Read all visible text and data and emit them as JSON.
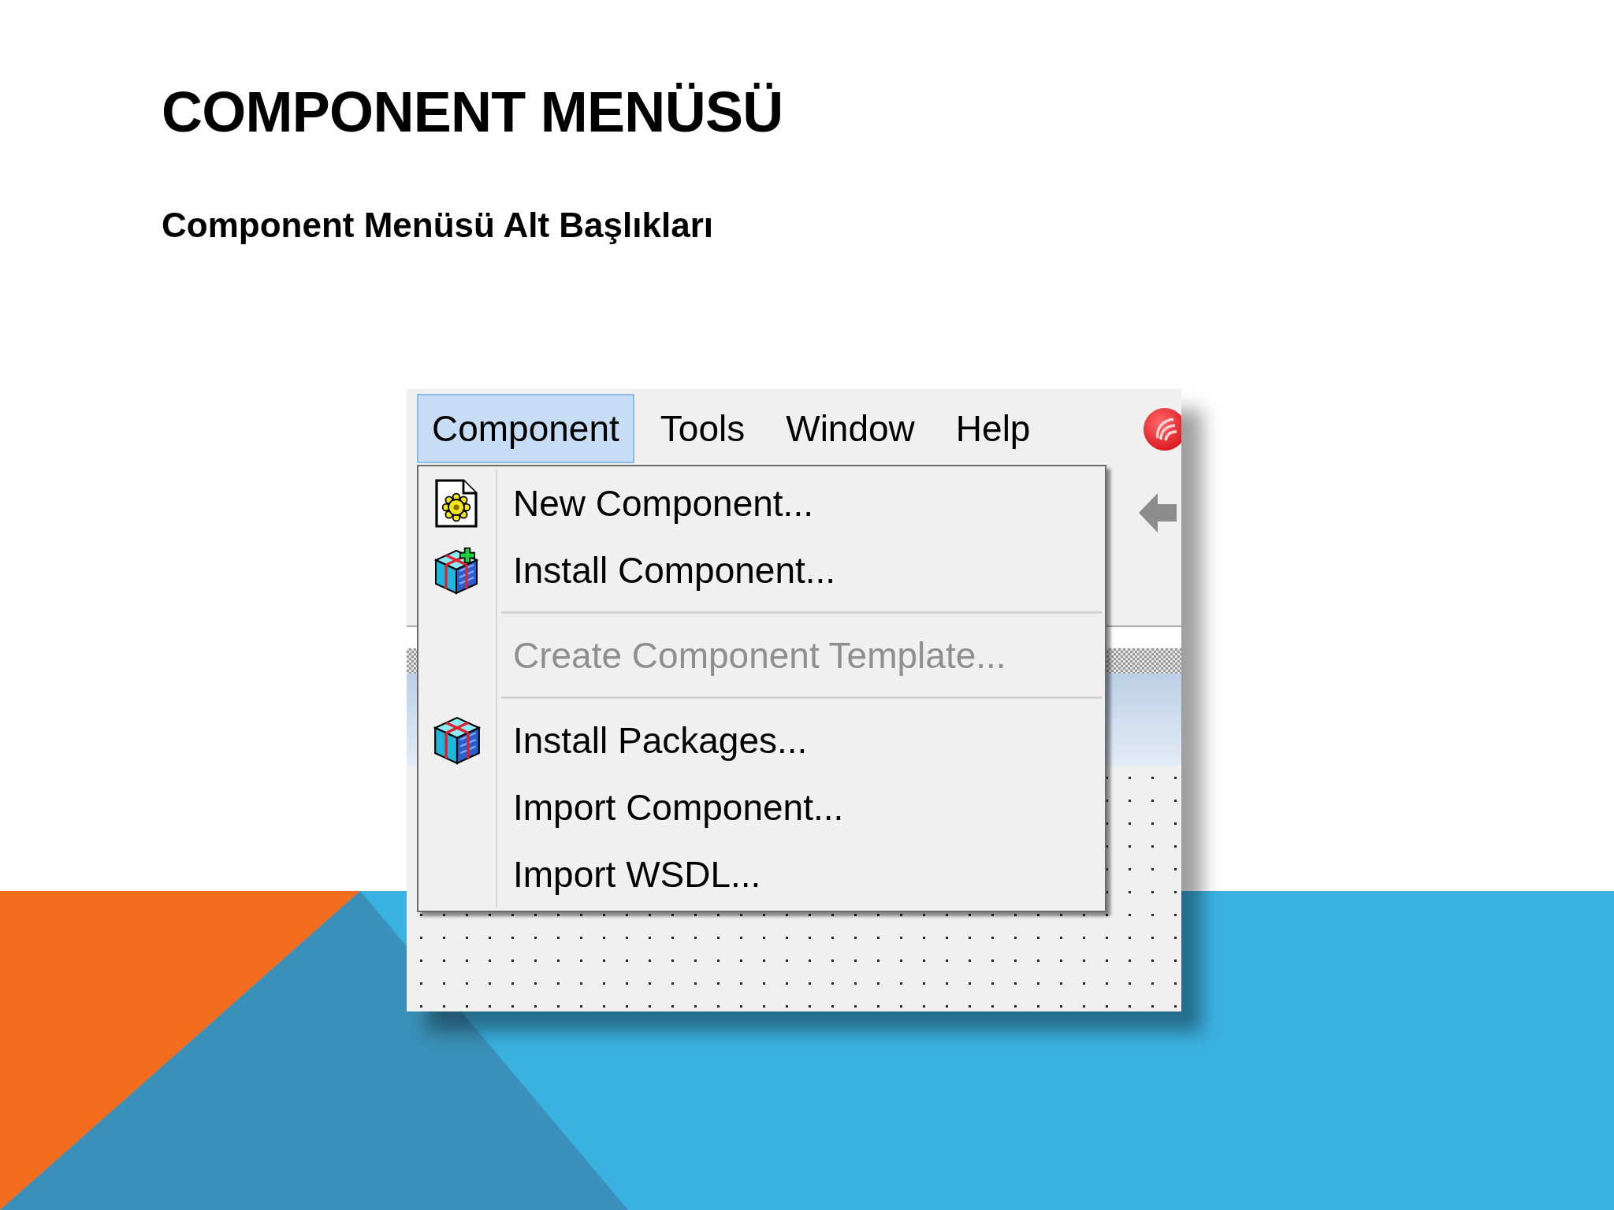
{
  "slide": {
    "title": "COMPONENT MENÜSÜ",
    "subtitle": "Component Menüsü Alt Başlıkları"
  },
  "app_window": {
    "menu_bar": [
      {
        "label": "Component",
        "selected": true
      },
      {
        "label": "Tools",
        "selected": false
      },
      {
        "label": "Window",
        "selected": false
      },
      {
        "label": "Help",
        "selected": false
      }
    ],
    "dropdown": {
      "items": [
        {
          "kind": "item",
          "label": "New Component...",
          "disabled": false
        },
        {
          "kind": "item",
          "label": "Install Component...",
          "disabled": false
        },
        {
          "kind": "separator"
        },
        {
          "kind": "item",
          "label": "Create Component Template...",
          "disabled": true
        },
        {
          "kind": "separator"
        },
        {
          "kind": "item",
          "label": "Install Packages...",
          "disabled": false
        },
        {
          "kind": "item",
          "label": "Import Component...",
          "disabled": false
        },
        {
          "kind": "item",
          "label": "Import WSDL...",
          "disabled": false
        }
      ]
    }
  }
}
